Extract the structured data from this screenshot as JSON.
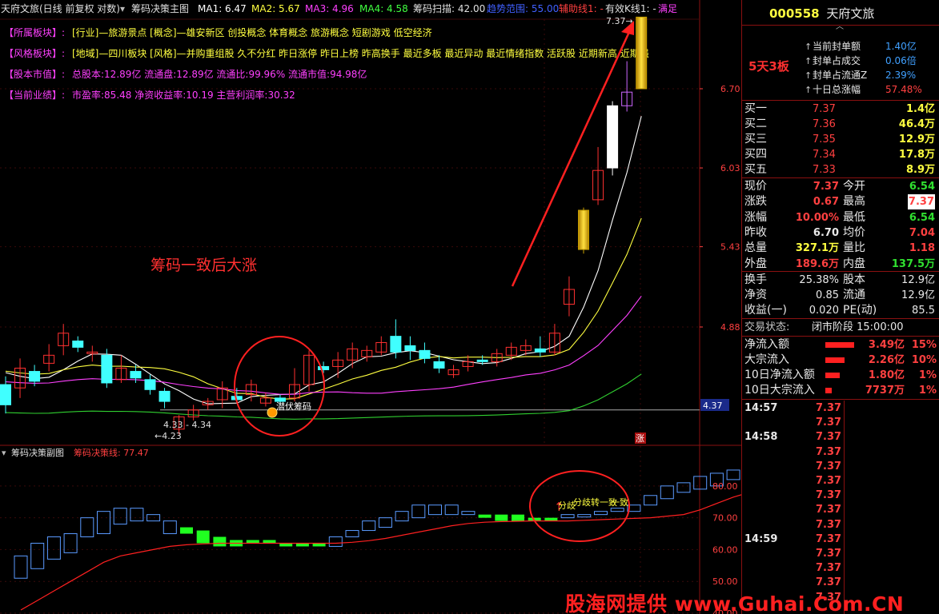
{
  "main_header": {
    "title": "天府文旅(日线 前复权 对数)",
    "indicator_name": "筹码决策主图",
    "ma1": "MA1: 6.47",
    "ma2": "MA2: 5.67",
    "ma3": "MA3: 4.96",
    "ma4": "MA4: 4.58",
    "scan": "筹码扫描: 42.00",
    "zone": "趋势范围: 55.00",
    "aux1": "辅助线1: -",
    "valid": "有效K线1: -",
    "satisfy": "满足"
  },
  "info_lines": [
    {
      "label": "【所属板块】:",
      "text": "[行业]—旅游景点 [概念]—雄安新区 创投概念 体育概念 旅游概念 短剧游戏 低空经济"
    },
    {
      "label": "【风格板块】:",
      "text": "[地域]—四川板块 [风格]—并购重组股 久不分红 昨日涨停 昨日上榜 昨高换手 最近多板 最近异动 最近情绪指数 活跃股 近期新高 近期强"
    },
    {
      "label": "【股本市值】:",
      "text": "总股本:12.89亿 流通盘:12.89亿 流通比:99.96% 流通市值:94.98亿"
    },
    {
      "label": "【当前业绩】:",
      "text": "市盈率:85.48 净资收益率:10.19 主营利润率:30.32"
    }
  ],
  "annotations": {
    "main_label": "筹码一致后大涨",
    "latent_label": "潜伏筹码",
    "range_label": "4.33 - 4.34",
    "low_label": "4.23",
    "high_label": "7.37",
    "zhang_badge": "涨",
    "sub_label_1": "分歧",
    "sub_label_2": "分歧转一致",
    "sub_label_3": "一致"
  },
  "price_axis": {
    "ticks": [
      "6.70",
      "6.03",
      "5.43",
      "4.88"
    ],
    "current": "4.37"
  },
  "sub_header": {
    "name": "筹码决策副图",
    "line": "筹码决策线: 77.47"
  },
  "sub_axis": {
    "ticks": [
      "80.00",
      "70.00",
      "60.00",
      "50.00",
      "40.00"
    ]
  },
  "watermark": "股海网提供 www.Guhai.Com.CN",
  "quote": {
    "code": "000558",
    "name": "天府文旅",
    "boards": "5天3板",
    "seal": [
      {
        "label": "当前封单额",
        "value": "1.40亿"
      },
      {
        "label": "封单占成交",
        "value": "0.06倍"
      },
      {
        "label": "封单占流通Z",
        "value": "2.39%"
      },
      {
        "label": "十日总涨幅",
        "value": "57.48%"
      }
    ],
    "bids": [
      {
        "label": "买一",
        "price": "7.37",
        "vol": "1.4亿"
      },
      {
        "label": "买二",
        "price": "7.36",
        "vol": "46.4万"
      },
      {
        "label": "买三",
        "price": "7.35",
        "vol": "12.9万"
      },
      {
        "label": "买四",
        "price": "7.34",
        "vol": "17.8万"
      },
      {
        "label": "买五",
        "price": "7.33",
        "vol": "8.9万"
      }
    ],
    "stats": [
      {
        "l1": "现价",
        "v1": "7.37",
        "c1": "red",
        "l2": "今开",
        "v2": "6.54",
        "c2": "green"
      },
      {
        "l1": "涨跌",
        "v1": "0.67",
        "c1": "red",
        "l2": "最高",
        "v2": "7.37",
        "c2": "red"
      },
      {
        "l1": "涨幅",
        "v1": "10.00%",
        "c1": "red",
        "l2": "最低",
        "v2": "6.54",
        "c2": "green"
      },
      {
        "l1": "昨收",
        "v1": "6.70",
        "c1": "white",
        "l2": "均价",
        "v2": "7.04",
        "c2": "red"
      },
      {
        "l1": "总量",
        "v1": "327.1万",
        "c1": "yellow",
        "l2": "量比",
        "v2": "1.18",
        "c2": "red"
      },
      {
        "l1": "外盘",
        "v1": "189.6万",
        "c1": "red",
        "l2": "内盘",
        "v2": "137.5万",
        "c2": "green"
      }
    ],
    "fund": [
      {
        "l1": "换手",
        "v1": "25.38%",
        "l2": "股本",
        "v2": "12.9亿"
      },
      {
        "l1": "净资",
        "v1": "0.85",
        "l2": "流通",
        "v2": "12.9亿"
      },
      {
        "l1": "收益(一)",
        "v1": "0.020",
        "l2": "PE(动)",
        "v2": "85.5"
      }
    ],
    "status": {
      "label": "交易状态:",
      "value": "闭市阶段 15:00:00"
    },
    "flows": [
      {
        "label": "净流入额",
        "value": "3.49亿",
        "pct": "15%",
        "w": 1.0
      },
      {
        "label": "大宗流入",
        "value": "2.26亿",
        "pct": "10%",
        "w": 0.67
      },
      {
        "label": "10日净流入额",
        "value": "1.80亿",
        "pct": "1%",
        "w": 0.5
      },
      {
        "label": "10日大宗流入",
        "value": "7737万",
        "pct": "1%",
        "w": 0.22
      }
    ],
    "ticks": [
      {
        "time": "14:57",
        "price": "7.37"
      },
      {
        "time": "",
        "price": "7.37"
      },
      {
        "time": "14:58",
        "price": "7.37"
      },
      {
        "time": "",
        "price": "7.37"
      },
      {
        "time": "",
        "price": "7.37"
      },
      {
        "time": "",
        "price": "7.37"
      },
      {
        "time": "",
        "price": "7.37"
      },
      {
        "time": "",
        "price": "7.37"
      },
      {
        "time": "",
        "price": "7.37"
      },
      {
        "time": "14:59",
        "price": "7.37"
      },
      {
        "time": "",
        "price": "7.37"
      },
      {
        "time": "",
        "price": "7.37"
      },
      {
        "time": "",
        "price": "7.37"
      },
      {
        "time": "",
        "price": "7.37"
      }
    ]
  },
  "chart_data": {
    "type": "candlestick",
    "title": "天府文旅(日线 前复权 对数)",
    "price_ticks": [
      6.7,
      6.03,
      5.43,
      4.88
    ],
    "candles": [
      {
        "o": 4.4,
        "c": 4.52,
        "h": 4.57,
        "l": 4.35,
        "color": "cyan"
      },
      {
        "o": 4.62,
        "c": 4.5,
        "h": 4.68,
        "l": 4.44,
        "color": "red"
      },
      {
        "o": 4.6,
        "c": 4.54,
        "h": 4.64,
        "l": 4.51,
        "color": "cyan"
      },
      {
        "o": 4.7,
        "c": 4.65,
        "h": 4.77,
        "l": 4.6,
        "color": "red"
      },
      {
        "o": 4.76,
        "c": 4.84,
        "h": 4.9,
        "l": 4.7,
        "color": "red"
      },
      {
        "o": 4.75,
        "c": 4.79,
        "h": 4.82,
        "l": 4.72,
        "color": "cyan"
      },
      {
        "o": 4.72,
        "c": 4.72,
        "h": 4.76,
        "l": 4.66,
        "color": "red"
      },
      {
        "o": 4.7,
        "c": 4.53,
        "h": 4.74,
        "l": 4.5,
        "color": "cyan"
      },
      {
        "o": 4.55,
        "c": 4.62,
        "h": 4.7,
        "l": 4.53,
        "color": "red"
      },
      {
        "o": 4.6,
        "c": 4.56,
        "h": 4.64,
        "l": 4.53,
        "color": "cyan"
      },
      {
        "o": 4.55,
        "c": 4.49,
        "h": 4.58,
        "l": 4.46,
        "color": "cyan"
      },
      {
        "o": 4.48,
        "c": 4.42,
        "h": 4.5,
        "l": 4.38,
        "color": "cyan"
      },
      {
        "o": 4.26,
        "c": 4.33,
        "h": 4.34,
        "l": 4.23,
        "color": "red"
      },
      {
        "o": 4.33,
        "c": 4.37,
        "h": 4.4,
        "l": 4.31,
        "color": "red"
      },
      {
        "o": 4.4,
        "c": 4.42,
        "h": 4.44,
        "l": 4.37,
        "color": "red"
      },
      {
        "o": 4.43,
        "c": 4.5,
        "h": 4.54,
        "l": 4.38,
        "color": "red"
      },
      {
        "o": 4.45,
        "c": 4.43,
        "h": 4.5,
        "l": 4.41,
        "color": "cyan"
      },
      {
        "o": 4.46,
        "c": 4.52,
        "h": 4.55,
        "l": 4.42,
        "color": "red"
      },
      {
        "o": 4.44,
        "c": 4.41,
        "h": 4.47,
        "l": 4.39,
        "color": "red"
      },
      {
        "o": 4.42,
        "c": 4.44,
        "h": 4.46,
        "l": 4.4,
        "color": "cyan"
      },
      {
        "o": 4.44,
        "c": 4.52,
        "h": 4.62,
        "l": 4.42,
        "color": "red"
      },
      {
        "o": 4.52,
        "c": 4.7,
        "h": 4.73,
        "l": 4.48,
        "color": "red"
      },
      {
        "o": 4.63,
        "c": 4.61,
        "h": 4.66,
        "l": 4.59,
        "color": "cyan"
      },
      {
        "o": 4.63,
        "c": 4.67,
        "h": 4.72,
        "l": 4.56,
        "color": "red"
      },
      {
        "o": 4.67,
        "c": 4.74,
        "h": 4.78,
        "l": 4.62,
        "color": "red"
      },
      {
        "o": 4.69,
        "c": 4.73,
        "h": 4.76,
        "l": 4.66,
        "color": "red"
      },
      {
        "o": 4.78,
        "c": 4.72,
        "h": 4.82,
        "l": 4.7,
        "color": "red"
      },
      {
        "o": 4.82,
        "c": 4.72,
        "h": 4.93,
        "l": 4.68,
        "color": "cyan"
      },
      {
        "o": 4.76,
        "c": 4.73,
        "h": 4.82,
        "l": 4.67,
        "color": "cyan"
      },
      {
        "o": 4.73,
        "c": 4.68,
        "h": 4.78,
        "l": 4.65,
        "color": "cyan"
      },
      {
        "o": 4.66,
        "c": 4.62,
        "h": 4.7,
        "l": 4.59,
        "color": "cyan"
      },
      {
        "o": 4.58,
        "c": 4.61,
        "h": 4.64,
        "l": 4.56,
        "color": "red"
      },
      {
        "o": 4.63,
        "c": 4.66,
        "h": 4.7,
        "l": 4.6,
        "color": "red"
      },
      {
        "o": 4.66,
        "c": 4.67,
        "h": 4.7,
        "l": 4.64,
        "color": "cyan"
      },
      {
        "o": 4.66,
        "c": 4.71,
        "h": 4.74,
        "l": 4.63,
        "color": "red"
      },
      {
        "o": 4.7,
        "c": 4.75,
        "h": 4.78,
        "l": 4.67,
        "color": "red"
      },
      {
        "o": 4.73,
        "c": 4.76,
        "h": 4.8,
        "l": 4.7,
        "color": "red"
      },
      {
        "o": 4.74,
        "c": 4.72,
        "h": 4.82,
        "l": 4.69,
        "color": "cyan"
      },
      {
        "o": 4.72,
        "c": 4.84,
        "h": 4.9,
        "l": 4.7,
        "color": "red"
      },
      {
        "o": 5.13,
        "c": 5.03,
        "h": 5.22,
        "l": 4.95,
        "color": "red"
      },
      {
        "o": 5.41,
        "c": 5.7,
        "h": 5.72,
        "l": 5.38,
        "color": "gold"
      },
      {
        "o": 5.78,
        "c": 6.01,
        "h": 6.2,
        "l": 5.74,
        "color": "red"
      },
      {
        "o": 6.03,
        "c": 6.55,
        "h": 6.59,
        "l": 5.97,
        "color": "white"
      },
      {
        "o": 6.55,
        "c": 6.67,
        "h": 6.95,
        "l": 6.5,
        "color": "purple"
      },
      {
        "o": 6.7,
        "c": 7.37,
        "h": 7.37,
        "l": 6.7,
        "color": "gold"
      }
    ],
    "sub_chart": {
      "title": "筹码决策副图",
      "ylim": [
        40,
        88
      ],
      "ticks": [
        80,
        70,
        60,
        50,
        40
      ],
      "bars": [
        [
          51,
          58,
          "blue"
        ],
        [
          54,
          62,
          "blue"
        ],
        [
          57,
          64,
          "blue"
        ],
        [
          59,
          65,
          "blue"
        ],
        [
          64,
          70,
          "blue"
        ],
        [
          65,
          72,
          "blue"
        ],
        [
          68,
          73,
          "blue"
        ],
        [
          69,
          73,
          "blue"
        ],
        [
          69,
          71,
          "blue"
        ],
        [
          65,
          69,
          "blue"
        ],
        [
          65,
          67,
          "green"
        ],
        [
          62,
          66,
          "green"
        ],
        [
          61,
          64,
          "green"
        ],
        [
          61,
          63,
          "green"
        ],
        [
          62,
          63,
          "green"
        ],
        [
          62,
          63,
          "green"
        ],
        [
          61,
          62,
          "green"
        ],
        [
          62,
          62,
          "green"
        ],
        [
          62,
          62,
          "green"
        ],
        [
          61,
          64,
          "blue"
        ],
        [
          64,
          66,
          "blue"
        ],
        [
          66,
          69,
          "blue"
        ],
        [
          67,
          70,
          "blue"
        ],
        [
          69,
          72,
          "blue"
        ],
        [
          70,
          74,
          "blue"
        ],
        [
          71,
          74,
          "blue"
        ],
        [
          71,
          74,
          "blue"
        ],
        [
          71,
          72,
          "blue"
        ],
        [
          70,
          71,
          "green"
        ],
        [
          69,
          71,
          "green"
        ],
        [
          69,
          71,
          "green"
        ],
        [
          69,
          70,
          "green"
        ],
        [
          70,
          70,
          "green"
        ],
        [
          70,
          71,
          "blue"
        ],
        [
          71,
          71,
          "blue"
        ],
        [
          71,
          72,
          "blue"
        ],
        [
          72,
          73,
          "blue"
        ],
        [
          72,
          74,
          "blue"
        ],
        [
          74,
          77,
          "blue"
        ],
        [
          76,
          80,
          "blue"
        ],
        [
          78,
          81,
          "blue"
        ],
        [
          79,
          83,
          "blue"
        ],
        [
          80,
          84,
          "blue"
        ],
        [
          82,
          85,
          "blue"
        ],
        [
          83,
          86,
          "blue"
        ]
      ],
      "line": [
        41,
        44,
        47,
        50,
        53,
        56,
        58,
        59,
        60,
        61,
        61.5,
        61.8,
        62,
        62,
        62,
        62,
        62,
        62,
        62,
        62,
        62.3,
        62.8,
        63.5,
        64.5,
        65.5,
        66.5,
        67.5,
        68.2,
        68.6,
        68.8,
        68.9,
        69,
        69,
        69,
        69.2,
        69.4,
        69.6,
        69.8,
        70,
        70.5,
        71,
        72.5,
        74.5,
        76.5,
        78
      ]
    }
  }
}
